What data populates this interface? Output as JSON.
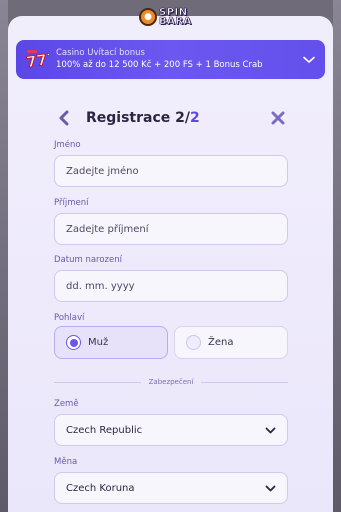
{
  "logo": {
    "line1": "SPIN",
    "line2": "BARA"
  },
  "bonus": {
    "title": "Casino Uvítací bonus",
    "description": "100% až do 12 500 Kč + 200 FS + 1 Bonus Crab",
    "icon": "777-icon"
  },
  "registration": {
    "title": "Registrace",
    "step": "2/",
    "total": "2"
  },
  "fields": {
    "first_name": {
      "label": "Jméno",
      "placeholder": "Zadejte jméno"
    },
    "last_name": {
      "label": "Příjmení",
      "placeholder": "Zadejte příjmení"
    },
    "birth_date": {
      "label": "Datum narození",
      "placeholder": "dd. mm. yyyy"
    }
  },
  "gender": {
    "label": "Pohlaví",
    "options": [
      {
        "label": "Muž",
        "selected": true
      },
      {
        "label": "Žena",
        "selected": false
      }
    ]
  },
  "security": {
    "divider_label": "Zabezpečení"
  },
  "country": {
    "label": "Země",
    "value": "Czech Republic"
  },
  "currency": {
    "label": "Měna",
    "value": "Czech Koruna"
  },
  "colors": {
    "accent": "#5a47e6",
    "label": "#6a5aa8",
    "panel": "#f1eefc"
  }
}
